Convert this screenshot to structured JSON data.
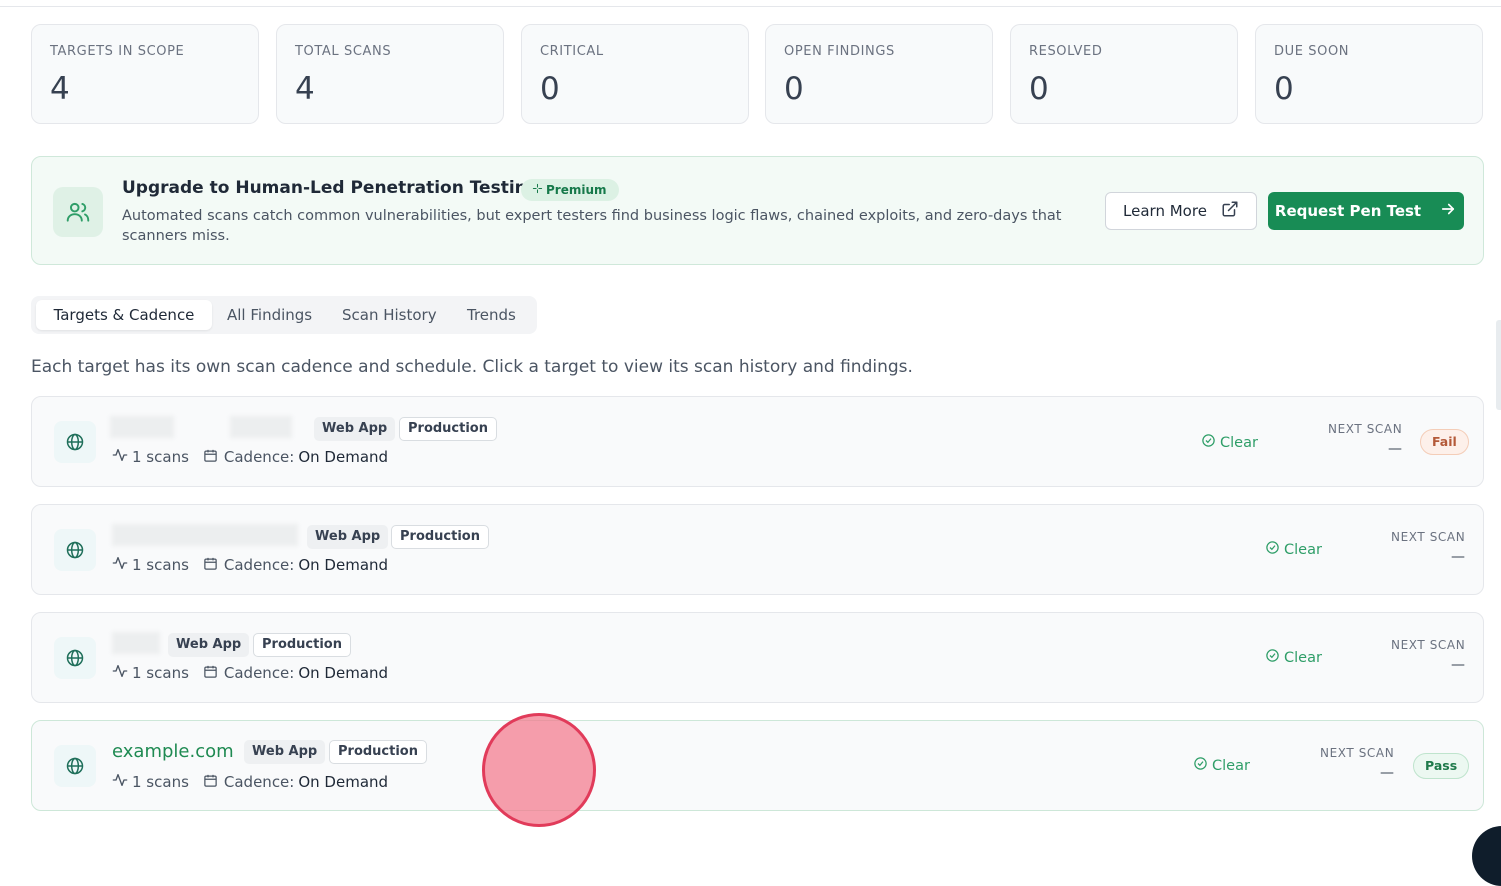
{
  "stats": [
    {
      "label": "TARGETS IN SCOPE",
      "value": "4"
    },
    {
      "label": "TOTAL SCANS",
      "value": "4"
    },
    {
      "label": "CRITICAL",
      "value": "0"
    },
    {
      "label": "OPEN FINDINGS",
      "value": "0"
    },
    {
      "label": "RESOLVED",
      "value": "0"
    },
    {
      "label": "DUE SOON",
      "value": "0"
    }
  ],
  "banner": {
    "title": "Upgrade to Human-Led Penetration Testing",
    "badge": "Premium",
    "description": "Automated scans catch common vulnerabilities, but expert testers find business logic flaws, chained exploits, and zero-days that scanners miss.",
    "learn_more": "Learn More",
    "request": "Request Pen Test",
    "icons": {
      "banner": "users-icon",
      "learn_more": "external-link-icon",
      "request": "arrow-right-icon",
      "badge": "sparkle-icon"
    }
  },
  "tabs": [
    "Targets & Cadence",
    "All Findings",
    "Scan History",
    "Trends"
  ],
  "hint": "Each target has its own scan cadence and schedule. Click a target to view its scan history and findings.",
  "targets": [
    {
      "name": "",
      "type": "Web App",
      "env": "Production",
      "scans": "1 scans",
      "cadence_label": "Cadence:",
      "cadence": "On Demand",
      "status": "Clear",
      "next_label": "NEXT SCAN",
      "next": "—",
      "result": "Fail"
    },
    {
      "name": "",
      "type": "Web App",
      "env": "Production",
      "scans": "1 scans",
      "cadence_label": "Cadence:",
      "cadence": "On Demand",
      "status": "Clear",
      "next_label": "NEXT SCAN",
      "next": "—",
      "result": ""
    },
    {
      "name": "",
      "type": "Web App",
      "env": "Production",
      "scans": "1 scans",
      "cadence_label": "Cadence:",
      "cadence": "On Demand",
      "status": "Clear",
      "next_label": "NEXT SCAN",
      "next": "—",
      "result": ""
    },
    {
      "name": "example.com",
      "type": "Web App",
      "env": "Production",
      "scans": "1 scans",
      "cadence_label": "Cadence:",
      "cadence": "On Demand",
      "status": "Clear",
      "next_label": "NEXT SCAN",
      "next": "—",
      "result": "Pass"
    }
  ],
  "colors": {
    "accent": "#188c55",
    "clear": "#2f9e68",
    "fail": "#b45a39",
    "pass": "#1f7a4b"
  }
}
